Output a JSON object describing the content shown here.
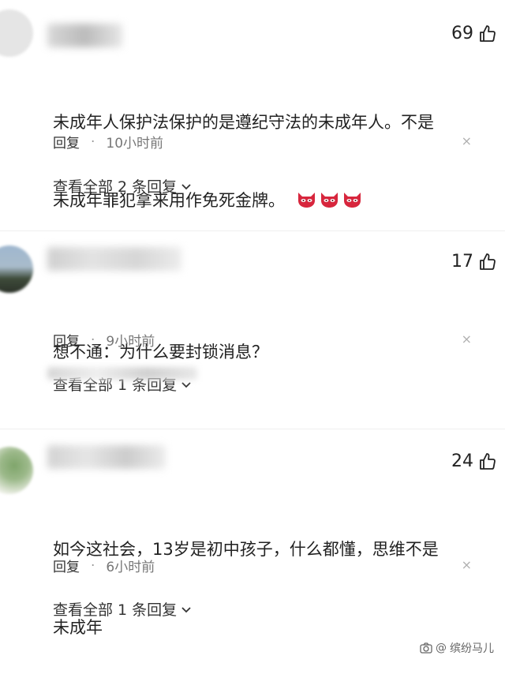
{
  "comments": [
    {
      "likes": "69",
      "text_line1": "未成年人保护法保护的是遵纪守法的未成年人。不是",
      "text_line2": "未成年罪犯拿来用作免死金牌。",
      "reply_label": "回复",
      "separator": "·",
      "time": "10小时前",
      "view_all": "查看全部 2 条回复"
    },
    {
      "likes": "17",
      "text_line1": "想不通：为什么要封锁消息？",
      "reply_label": "回复",
      "separator": "·",
      "time": "9小时前",
      "view_all": "查看全部 1 条回复"
    },
    {
      "likes": "24",
      "text_line1": "如今这社会，13岁是初中孩子，什么都懂，思维不是",
      "text_line2": "未成年",
      "reply_label": "回复",
      "separator": "·",
      "time": "6小时前",
      "view_all": "查看全部 1 条回复"
    }
  ],
  "icons": {
    "like": "thumbs-up-icon",
    "close": "close-icon",
    "expand": "chevron-down-icon",
    "emoji": "devil-face-emoji-icon"
  },
  "close_glyph": "×",
  "watermark": {
    "text": "缤纷马儿"
  },
  "colors": {
    "text": "#222222",
    "meta": "#777777",
    "emoji_red": "#d7263d"
  }
}
